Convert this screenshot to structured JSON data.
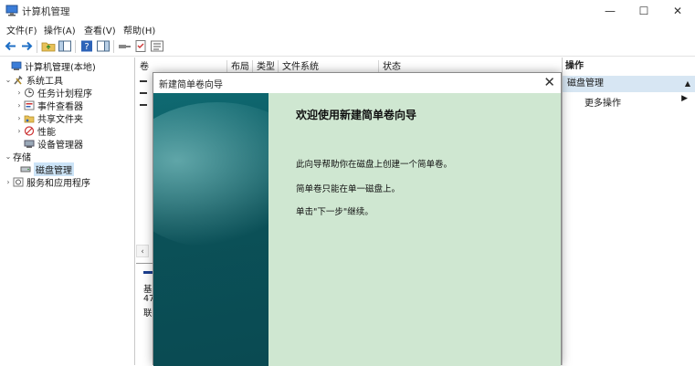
{
  "window": {
    "title": "计算机管理",
    "minimize": "—",
    "maximize": "☐",
    "close": "✕"
  },
  "menu": [
    "文件(F)",
    "操作(A)",
    "查看(V)",
    "帮助(H)"
  ],
  "toolbar": {
    "icons": [
      "back-arrow-icon",
      "forward-arrow-icon",
      "up-folder-icon",
      "console-tree-icon",
      "help-icon",
      "action-pane-icon",
      "connect-icon",
      "checklist-icon",
      "properties-icon"
    ]
  },
  "tree": {
    "root": "计算机管理(本地)",
    "items": [
      {
        "label": "系统工具",
        "level": 1
      },
      {
        "label": "任务计划程序",
        "level": 2
      },
      {
        "label": "事件查看器",
        "level": 2
      },
      {
        "label": "共享文件夹",
        "level": 2
      },
      {
        "label": "性能",
        "level": 2
      },
      {
        "label": "设备管理器",
        "level": 2
      },
      {
        "label": "存储",
        "level": 1
      },
      {
        "label": "磁盘管理",
        "level": 2
      },
      {
        "label": "服务和应用程序",
        "level": 1
      }
    ]
  },
  "volume_list": {
    "columns": [
      "卷",
      "布局",
      "类型",
      "文件系统",
      "状态"
    ]
  },
  "disk_panel": {
    "fragments": [
      "基",
      "47",
      "联"
    ]
  },
  "actions": {
    "title": "操作",
    "section": "磁盘管理",
    "more": "更多操作"
  },
  "wizard": {
    "title": "新建简单卷向导",
    "heading": "欢迎使用新建简单卷向导",
    "para1": "此向导帮助你在磁盘上创建一个简单卷。",
    "para2": "简单卷只能在单一磁盘上。",
    "para3": "单击\"下一步\"继续。"
  },
  "colors": {
    "wizard_panel": "#cfe7d1",
    "wizard_side": "#0b5158",
    "selection": "#cce4f7",
    "action_section": "#d7e6f3"
  }
}
